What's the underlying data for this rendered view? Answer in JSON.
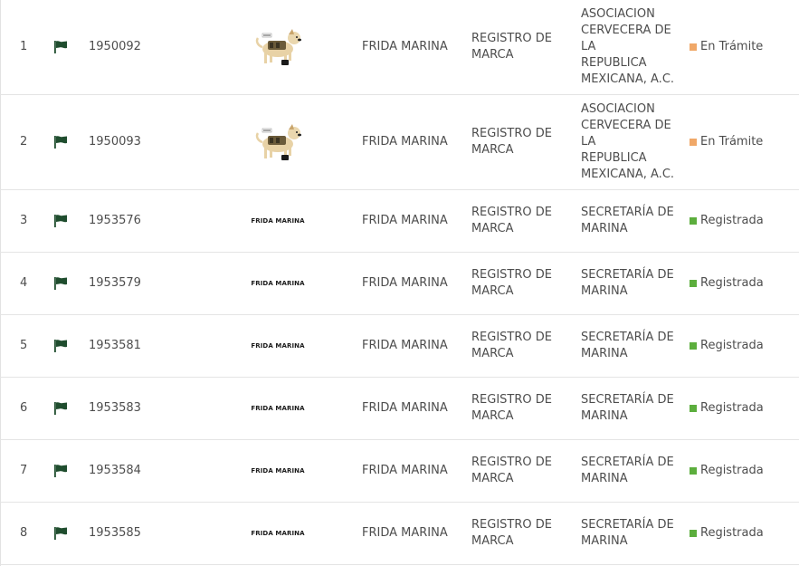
{
  "colors": {
    "flag": "#1f4d2e",
    "status_tramite": "#f0a868",
    "status_registrada": "#5cae3d"
  },
  "rows": [
    {
      "num": "1",
      "file": "1950092",
      "mark_type": "image",
      "mark_icon": "dog-icon",
      "name": "FRIDA MARINA",
      "type_lines": [
        "REGISTRO DE",
        "MARCA"
      ],
      "owner_lines": [
        "ASOCIACION",
        "CERVECERA DE LA",
        "REPUBLICA",
        "MEXICANA, A.C."
      ],
      "status": "En Trámite",
      "status_kind": "tramite"
    },
    {
      "num": "2",
      "file": "1950093",
      "mark_type": "image",
      "mark_icon": "dog-icon",
      "name": "FRIDA MARINA",
      "type_lines": [
        "REGISTRO DE",
        "MARCA"
      ],
      "owner_lines": [
        "ASOCIACION",
        "CERVECERA DE LA",
        "REPUBLICA",
        "MEXICANA, A.C."
      ],
      "status": "En Trámite",
      "status_kind": "tramite"
    },
    {
      "num": "3",
      "file": "1953576",
      "mark_type": "text",
      "mark_text": "FRIDA MARINA",
      "name": "FRIDA MARINA",
      "type_lines": [
        "REGISTRO DE",
        "MARCA"
      ],
      "owner_lines": [
        "SECRETARÍA DE",
        "MARINA"
      ],
      "status": "Registrada",
      "status_kind": "registrada"
    },
    {
      "num": "4",
      "file": "1953579",
      "mark_type": "text",
      "mark_text": "FRIDA MARINA",
      "name": "FRIDA MARINA",
      "type_lines": [
        "REGISTRO DE",
        "MARCA"
      ],
      "owner_lines": [
        "SECRETARÍA DE",
        "MARINA"
      ],
      "status": "Registrada",
      "status_kind": "registrada"
    },
    {
      "num": "5",
      "file": "1953581",
      "mark_type": "text",
      "mark_text": "FRIDA MARINA",
      "name": "FRIDA MARINA",
      "type_lines": [
        "REGISTRO DE",
        "MARCA"
      ],
      "owner_lines": [
        "SECRETARÍA DE",
        "MARINA"
      ],
      "status": "Registrada",
      "status_kind": "registrada"
    },
    {
      "num": "6",
      "file": "1953583",
      "mark_type": "text",
      "mark_text": "FRIDA MARINA",
      "name": "FRIDA MARINA",
      "type_lines": [
        "REGISTRO DE",
        "MARCA"
      ],
      "owner_lines": [
        "SECRETARÍA DE",
        "MARINA"
      ],
      "status": "Registrada",
      "status_kind": "registrada"
    },
    {
      "num": "7",
      "file": "1953584",
      "mark_type": "text",
      "mark_text": "FRIDA MARINA",
      "name": "FRIDA MARINA",
      "type_lines": [
        "REGISTRO DE",
        "MARCA"
      ],
      "owner_lines": [
        "SECRETARÍA DE",
        "MARINA"
      ],
      "status": "Registrada",
      "status_kind": "registrada"
    },
    {
      "num": "8",
      "file": "1953585",
      "mark_type": "text",
      "mark_text": "FRIDA MARINA",
      "name": "FRIDA MARINA",
      "type_lines": [
        "REGISTRO DE",
        "MARCA"
      ],
      "owner_lines": [
        "SECRETARÍA DE",
        "MARINA"
      ],
      "status": "Registrada",
      "status_kind": "registrada"
    }
  ]
}
